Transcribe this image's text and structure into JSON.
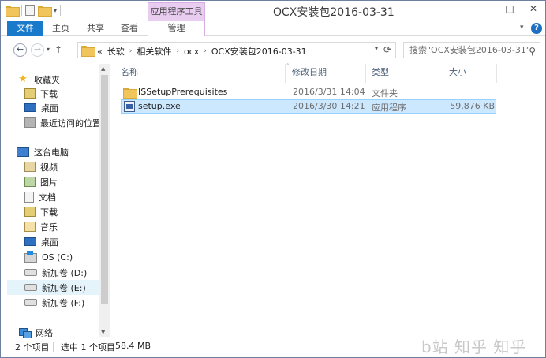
{
  "window": {
    "title": "OCX安装包2016-03-31",
    "context_tool_group": "应用程序工具",
    "controls": [
      "–",
      "□",
      "✕"
    ]
  },
  "ribbon": {
    "tabs": {
      "file": "文件",
      "home": "主页",
      "share": "共享",
      "view": "查看",
      "manage": "管理"
    },
    "help": "?"
  },
  "address": {
    "overflow": "«",
    "crumbs": [
      "长软",
      "相关软件",
      "ocx",
      "OCX安装包2016-03-31"
    ]
  },
  "search": {
    "placeholder": "搜索\"OCX安装包2016-03-31\""
  },
  "nav": {
    "favorites": "收藏夹",
    "fav_items": [
      "下载",
      "桌面",
      "最近访问的位置"
    ],
    "this_pc": "这台电脑",
    "pc_items": [
      "视频",
      "图片",
      "文档",
      "下载",
      "音乐",
      "桌面",
      "OS (C:)",
      "新加卷 (D:)",
      "新加卷 (E:)",
      "新加卷 (F:)"
    ],
    "network": "网络"
  },
  "columns": {
    "name": "名称",
    "modified": "修改日期",
    "type": "类型",
    "size": "大小"
  },
  "files": [
    {
      "name": "ISSetupPrerequisites",
      "modified": "2016/3/31 14:04",
      "type": "文件夹",
      "size": "",
      "icon": "folder-icon"
    },
    {
      "name": "setup.exe",
      "modified": "2016/3/30 14:21",
      "type": "应用程序",
      "size": "59,876 KB",
      "icon": "exe-icon"
    }
  ],
  "status": {
    "count": "2 个项目",
    "selection": "选中 1 个项目",
    "size": "58.4 MB"
  },
  "watermark": "b站 知乎 知乎"
}
